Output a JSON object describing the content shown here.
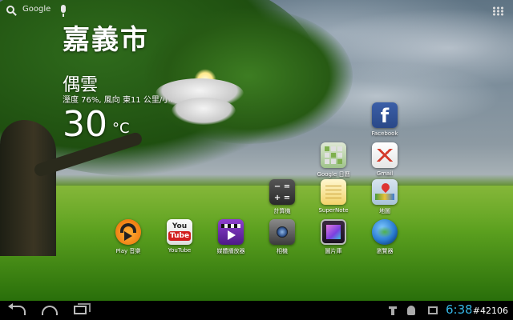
{
  "top_bar": {
    "search_label": "Google",
    "icons": [
      "search-icon",
      "mic-icon",
      "apps-grid-icon"
    ]
  },
  "weather": {
    "city": "嘉義市",
    "condition": "偶雲",
    "details": "溼度 76%, 風向 東11 公里/小時",
    "temperature": "30",
    "unit": "°C",
    "icon": "partly-cloudy-icon"
  },
  "home_icons": [
    {
      "label": "Facebook",
      "icon": "facebook-icon",
      "glyph": "f"
    },
    {
      "label": "Google 日曆",
      "icon": "google-calendar-icon"
    },
    {
      "label": "Gmail",
      "icon": "gmail-icon"
    },
    {
      "label": "計算機",
      "icon": "calculator-icon",
      "glyph": "− =\n+ ="
    },
    {
      "label": "SuperNote",
      "icon": "supernote-icon"
    },
    {
      "label": "地圖",
      "icon": "maps-icon"
    },
    {
      "label": "Play 音樂",
      "icon": "play-music-icon"
    },
    {
      "label": "YouTube",
      "icon": "youtube-icon",
      "glyph_a": "You",
      "glyph_b": "Tube"
    },
    {
      "label": "媒體播放器",
      "icon": "media-player-icon"
    },
    {
      "label": "相機",
      "icon": "camera-icon"
    },
    {
      "label": "圖片庫",
      "icon": "gallery-icon"
    },
    {
      "label": "瀏覽器",
      "icon": "browser-icon"
    }
  ],
  "navbar": {
    "clock": "6:38",
    "icons": [
      "back-icon",
      "home-icon",
      "recent-apps-icon",
      "usb-icon",
      "debug-icon",
      "screenshot-icon"
    ]
  },
  "watermark": "#42106",
  "colors": {
    "clock": "#35b6e5",
    "navbar_bg": "#000000"
  }
}
